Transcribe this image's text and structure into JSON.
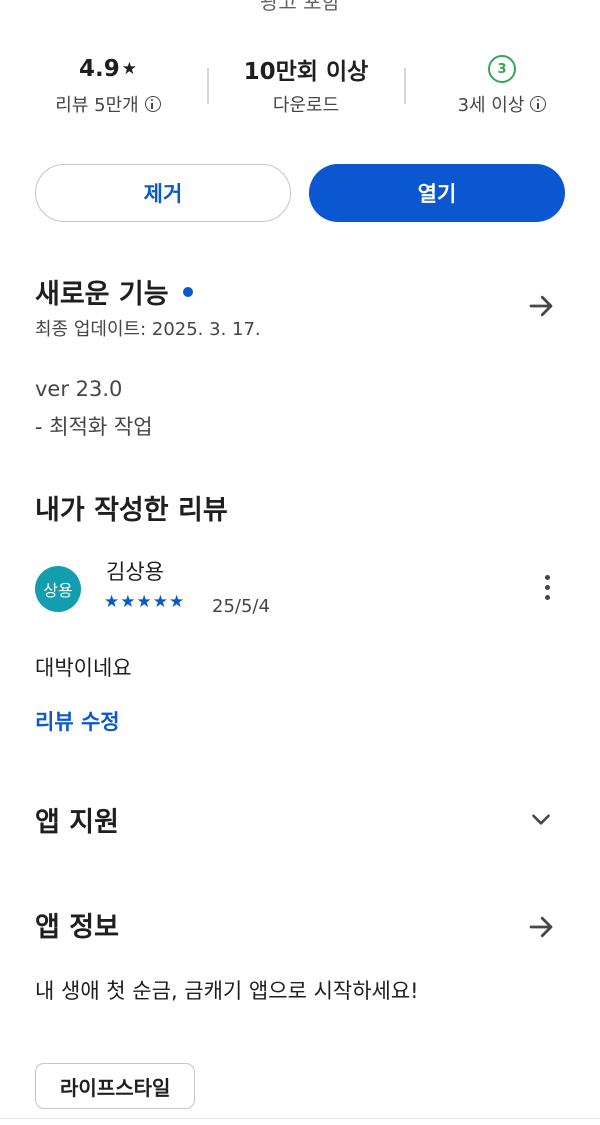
{
  "header": {
    "cut_text": "광고 포함"
  },
  "stats": {
    "rating": {
      "value": "4.9",
      "star": "★",
      "sub": "리뷰 5만개",
      "icon": "info-icon"
    },
    "downloads": {
      "value": "10만회 이상",
      "sub": "다운로드"
    },
    "age": {
      "badge": "3",
      "sub": "3세 이상",
      "icon": "info-icon"
    }
  },
  "actions": {
    "remove_label": "제거",
    "open_label": "열기"
  },
  "whats_new": {
    "title": "새로운 기능",
    "updated": "최종 업데이트: 2025. 3. 17.",
    "notes": [
      "ver 23.0",
      "- 최적화 작업"
    ]
  },
  "my_review": {
    "title": "내가 작성한 리뷰",
    "avatar_text": "상용",
    "reviewer": "김상용",
    "stars": "★★★★★",
    "rating": 5,
    "date": "25/5/4",
    "text": "대박이네요",
    "edit_label": "리뷰 수정"
  },
  "app_support": {
    "title": "앱 지원"
  },
  "app_info": {
    "title": "앱 정보",
    "description": "내 생애 첫 순금, 금캐기 앱으로 시작하세요!",
    "category_chip": "라이프스타일"
  },
  "colors": {
    "accent": "#0b57d0",
    "avatar": "#129eaf",
    "age_badge": "#34a853",
    "text": "#1f1f1f",
    "muted": "#444746"
  }
}
